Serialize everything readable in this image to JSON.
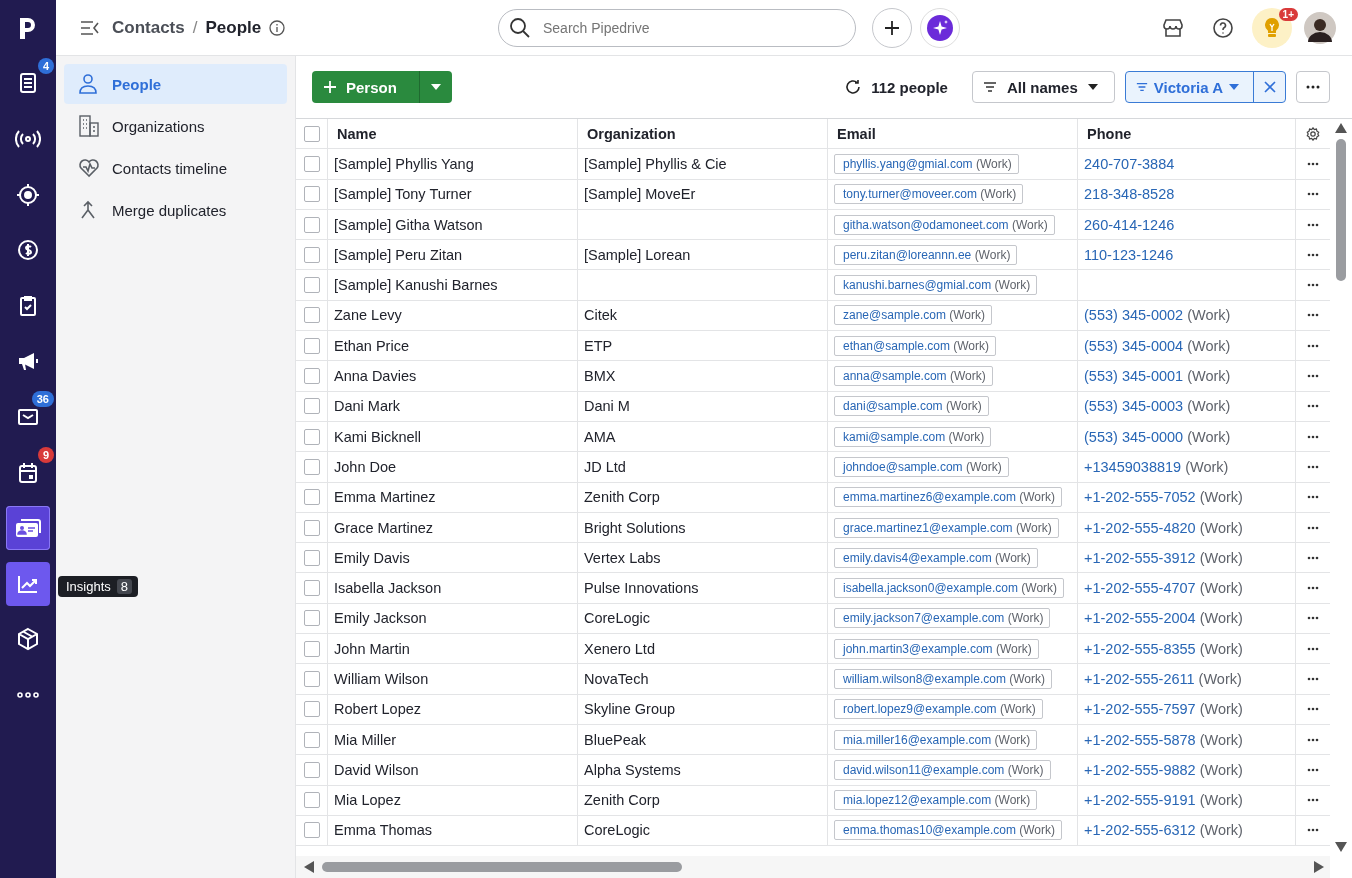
{
  "nav_rail": [
    {
      "selected": false,
      "hovered": false
    },
    {
      "badge": "4",
      "color": "#2f6fd8",
      "selected": false,
      "hovered": false
    },
    {
      "selected": false,
      "hovered": false
    },
    {
      "selected": false,
      "hovered": false
    },
    {
      "selected": false,
      "hovered": false
    },
    {
      "selected": false,
      "hovered": false
    },
    {
      "selected": false,
      "hovered": false
    },
    {
      "badge": "36",
      "color": "#2f6fd8",
      "selected": false,
      "hovered": false
    },
    {
      "badge": "9",
      "color": "#d93a3a",
      "selected": false,
      "hovered": false
    },
    {
      "selected": true,
      "hovered": false
    },
    {
      "selected": false,
      "hovered": true
    },
    {
      "selected": false,
      "hovered": false
    },
    {
      "selected": false,
      "hovered": false
    }
  ],
  "tooltip": {
    "label": "Insights",
    "count": "8"
  },
  "breadcrumb": {
    "parent": "Contacts",
    "separator": "/",
    "current": "People"
  },
  "search": {
    "placeholder": "Search Pipedrive"
  },
  "notifications_badge": "1+",
  "side_menu": [
    {
      "label": "People",
      "selected": true
    },
    {
      "label": "Organizations",
      "selected": false
    },
    {
      "label": "Contacts timeline",
      "selected": false
    },
    {
      "label": "Merge duplicates",
      "selected": false
    }
  ],
  "toolbar": {
    "add_button": "Person",
    "count": "112 people",
    "filter": "All names",
    "active_filter": "Victoria A"
  },
  "table": {
    "columns": [
      "Name",
      "Organization",
      "Email",
      "Phone"
    ],
    "all_checked": false,
    "rows": [
      {
        "checked": false,
        "name": "[Sample] Phyllis Yang",
        "organization": "[Sample] Phyllis & Cie",
        "email": "phyllis.yang@gmial.com",
        "email_type": "(Work)",
        "phone": "240-707-3884",
        "phone_type": ""
      },
      {
        "checked": false,
        "name": "[Sample] Tony Turner",
        "organization": "[Sample] MoveEr",
        "email": "tony.turner@moveer.com",
        "email_type": "(Work)",
        "phone": "218-348-8528",
        "phone_type": ""
      },
      {
        "checked": false,
        "name": "[Sample] Githa Watson",
        "organization": "",
        "email": "githa.watson@odamoneet.com",
        "email_type": "(Work)",
        "phone": "260-414-1246",
        "phone_type": ""
      },
      {
        "checked": false,
        "name": "[Sample] Peru Zitan",
        "organization": "[Sample] Lorean",
        "email": "peru.zitan@loreannn.ee",
        "email_type": "(Work)",
        "phone": "110-123-1246",
        "phone_type": ""
      },
      {
        "checked": false,
        "name": "[Sample] Kanushi Barnes",
        "organization": "",
        "email": "kanushi.barnes@gmial.com",
        "email_type": "(Work)",
        "phone": "",
        "phone_type": ""
      },
      {
        "checked": false,
        "name": "Zane Levy",
        "organization": "Citek",
        "email": "zane@sample.com",
        "email_type": "(Work)",
        "phone": "(553) 345-0002",
        "phone_type": "(Work)"
      },
      {
        "checked": false,
        "name": "Ethan Price",
        "organization": "ETP",
        "email": "ethan@sample.com",
        "email_type": "(Work)",
        "phone": "(553) 345-0004",
        "phone_type": "(Work)"
      },
      {
        "checked": false,
        "name": "Anna Davies",
        "organization": "BMX",
        "email": "anna@sample.com",
        "email_type": "(Work)",
        "phone": "(553) 345-0001",
        "phone_type": "(Work)"
      },
      {
        "checked": false,
        "name": "Dani Mark",
        "organization": "Dani M",
        "email": "dani@sample.com",
        "email_type": "(Work)",
        "phone": "(553) 345-0003",
        "phone_type": "(Work)"
      },
      {
        "checked": false,
        "name": "Kami Bicknell",
        "organization": "AMA",
        "email": "kami@sample.com",
        "email_type": "(Work)",
        "phone": "(553) 345-0000",
        "phone_type": "(Work)"
      },
      {
        "checked": false,
        "name": "John Doe",
        "organization": "JD Ltd",
        "email": "johndoe@sample.com",
        "email_type": "(Work)",
        "phone": "+13459038819",
        "phone_type": "(Work)"
      },
      {
        "checked": false,
        "name": "Emma Martinez",
        "organization": "Zenith Corp",
        "email": "emma.martinez6@example.com",
        "email_type": "(Work)",
        "phone": "+1-202-555-7052",
        "phone_type": "(Work)"
      },
      {
        "checked": false,
        "name": "Grace Martinez",
        "organization": "Bright Solutions",
        "email": "grace.martinez1@example.com",
        "email_type": "(Work)",
        "phone": "+1-202-555-4820",
        "phone_type": "(Work)"
      },
      {
        "checked": false,
        "name": "Emily Davis",
        "organization": "Vertex Labs",
        "email": "emily.davis4@example.com",
        "email_type": "(Work)",
        "phone": "+1-202-555-3912",
        "phone_type": "(Work)"
      },
      {
        "checked": false,
        "name": "Isabella Jackson",
        "organization": "Pulse Innovations",
        "email": "isabella.jackson0@example.com",
        "email_type": "(Work)",
        "phone": "+1-202-555-4707",
        "phone_type": "(Work)"
      },
      {
        "checked": false,
        "name": "Emily Jackson",
        "organization": "CoreLogic",
        "email": "emily.jackson7@example.com",
        "email_type": "(Work)",
        "phone": "+1-202-555-2004",
        "phone_type": "(Work)"
      },
      {
        "checked": false,
        "name": "John Martin",
        "organization": "Xenero Ltd",
        "email": "john.martin3@example.com",
        "email_type": "(Work)",
        "phone": "+1-202-555-8355",
        "phone_type": "(Work)"
      },
      {
        "checked": false,
        "name": "William Wilson",
        "organization": "NovaTech",
        "email": "william.wilson8@example.com",
        "email_type": "(Work)",
        "phone": "+1-202-555-2611",
        "phone_type": "(Work)"
      },
      {
        "checked": false,
        "name": "Robert Lopez",
        "organization": "Skyline Group",
        "email": "robert.lopez9@example.com",
        "email_type": "(Work)",
        "phone": "+1-202-555-7597",
        "phone_type": "(Work)"
      },
      {
        "checked": false,
        "name": "Mia Miller",
        "organization": "BluePeak",
        "email": "mia.miller16@example.com",
        "email_type": "(Work)",
        "phone": "+1-202-555-5878",
        "phone_type": "(Work)"
      },
      {
        "checked": false,
        "name": "David Wilson",
        "organization": "Alpha Systems",
        "email": "david.wilson11@example.com",
        "email_type": "(Work)",
        "phone": "+1-202-555-9882",
        "phone_type": "(Work)"
      },
      {
        "checked": false,
        "name": "Mia Lopez",
        "organization": "Zenith Corp",
        "email": "mia.lopez12@example.com",
        "email_type": "(Work)",
        "phone": "+1-202-555-9191",
        "phone_type": "(Work)"
      },
      {
        "checked": false,
        "name": "Emma Thomas",
        "organization": "CoreLogic",
        "email": "emma.thomas10@example.com",
        "email_type": "(Work)",
        "phone": "+1-202-555-6312",
        "phone_type": "(Work)"
      }
    ]
  }
}
